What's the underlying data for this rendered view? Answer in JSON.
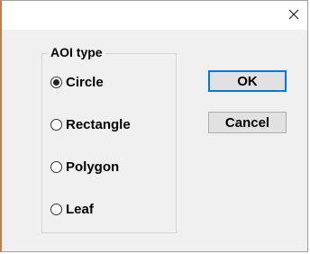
{
  "dialog": {
    "close_symbol": "×",
    "group_title": "AOI type",
    "options": [
      {
        "label": "Circle",
        "checked": true
      },
      {
        "label": "Rectangle",
        "checked": false
      },
      {
        "label": "Polygon",
        "checked": false
      },
      {
        "label": "Leaf",
        "checked": false
      }
    ],
    "ok_label": "OK",
    "cancel_label": "Cancel"
  },
  "colors": {
    "default_button_border": "#0078d7",
    "dialog_background": "#f0f0f0",
    "titlebar_background": "#ffffff"
  }
}
